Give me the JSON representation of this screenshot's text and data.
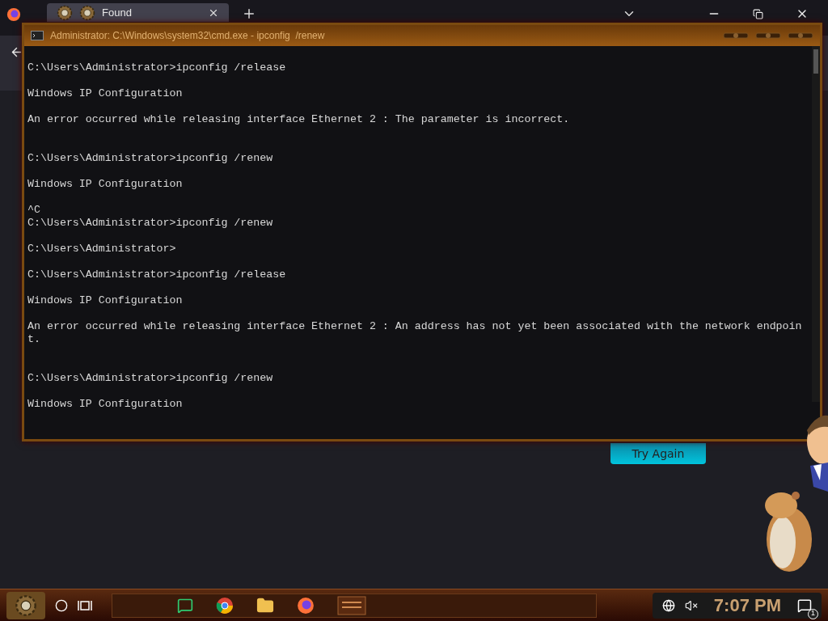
{
  "browser": {
    "tab": {
      "title": "Found",
      "selected": true
    }
  },
  "error_page": {
    "button": "Try Again"
  },
  "console": {
    "title": "Administrator: C:\\Windows\\system32\\cmd.exe - ipconfig  /renew",
    "output": "C:\\Users\\Administrator>ipconfig /release\n\nWindows IP Configuration\n\nAn error occurred while releasing interface Ethernet 2 : The parameter is incorrect.\n\n\nC:\\Users\\Administrator>ipconfig /renew\n\nWindows IP Configuration\n\n^C\nC:\\Users\\Administrator>ipconfig /renew\n\nC:\\Users\\Administrator>\n\nC:\\Users\\Administrator>ipconfig /release\n\nWindows IP Configuration\n\nAn error occurred while releasing interface Ethernet 2 : An address has not yet been associated with the network endpoin\nt.\n\n\nC:\\Users\\Administrator>ipconfig /renew\n\nWindows IP Configuration"
  },
  "taskbar": {
    "clock": "7:07 PM",
    "notification_count": "1",
    "muted": true
  }
}
